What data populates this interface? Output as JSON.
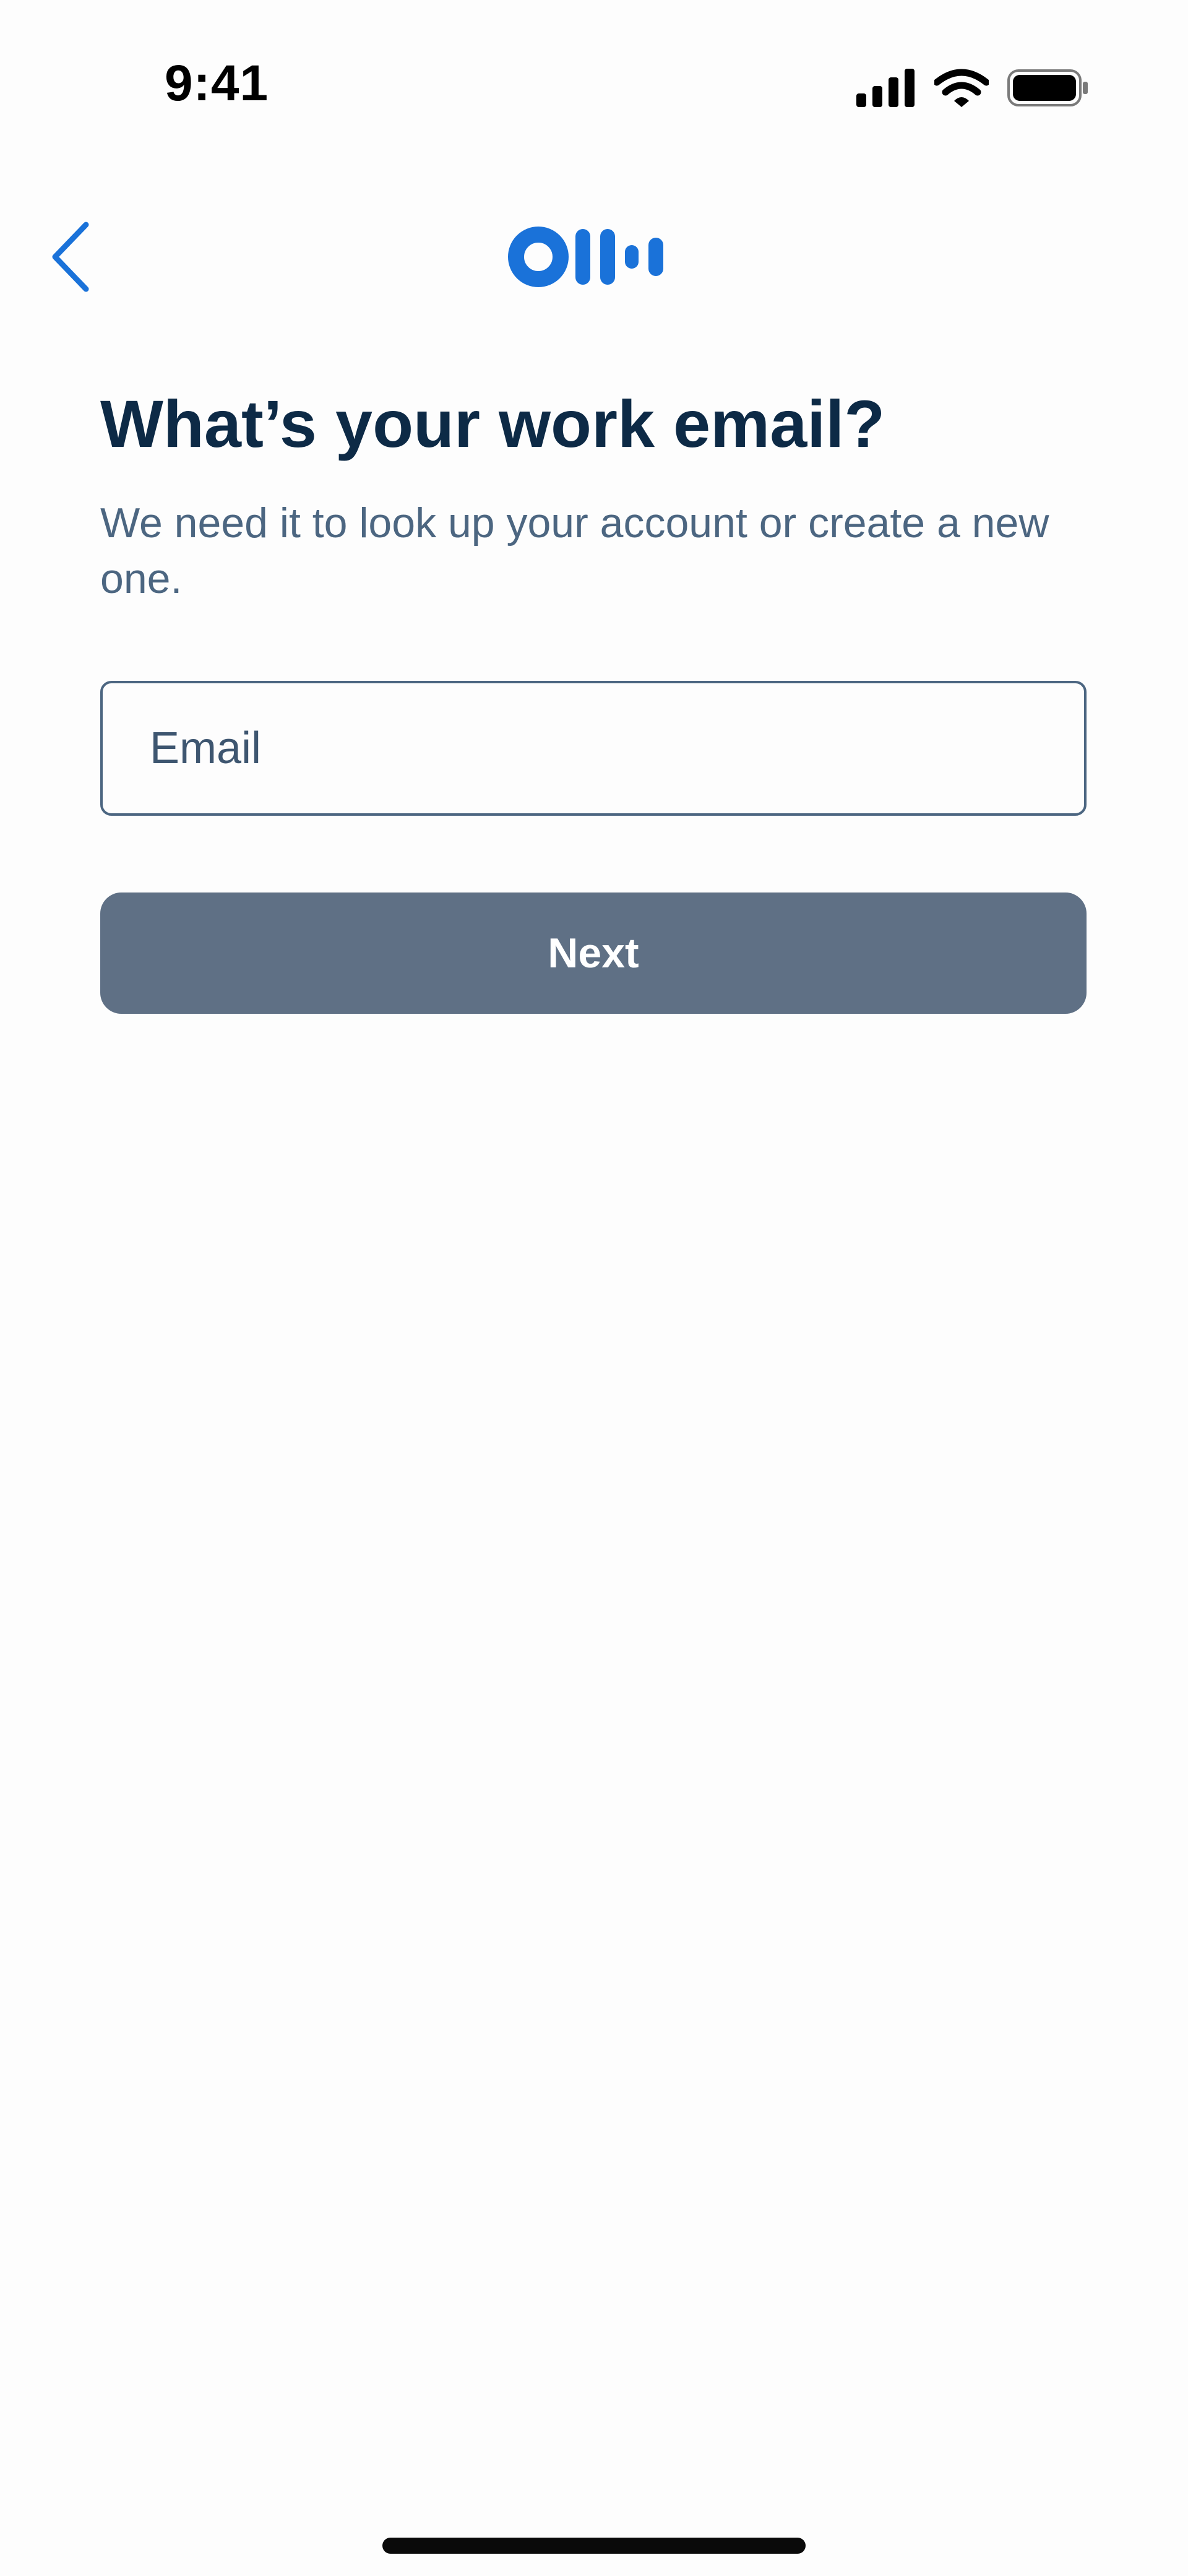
{
  "status_bar": {
    "time": "9:41",
    "icons": [
      "signal-icon",
      "wifi-icon",
      "battery-icon"
    ]
  },
  "nav": {
    "back_icon": "chevron-left-icon",
    "logo_icon": "otter-logo-icon"
  },
  "content": {
    "title": "What’s your work email?",
    "subtitle": "We need it to look up your account or create a new one.",
    "email_field": {
      "placeholder": "Email",
      "value": ""
    },
    "next_label": "Next"
  },
  "colors": {
    "brand_blue": "#1a72d9",
    "title_text": "#0d2a46",
    "subtitle_text": "#4c6681",
    "button_disabled": "#5f7085",
    "background": "#fdfdfd"
  }
}
